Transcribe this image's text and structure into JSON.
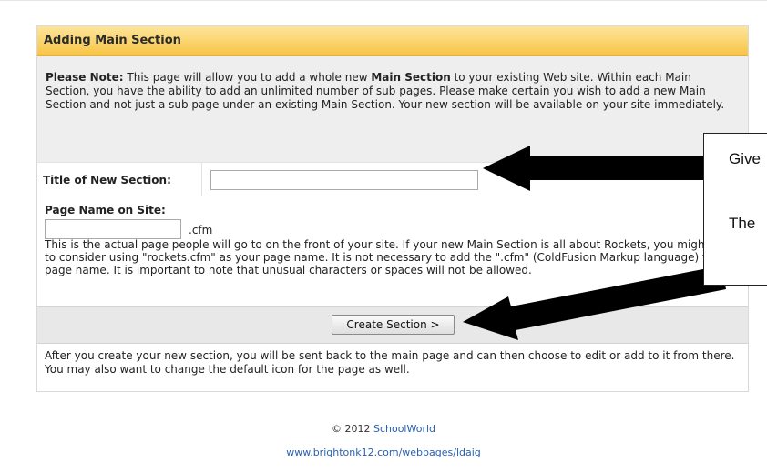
{
  "header": {
    "title": "Adding Main Section"
  },
  "note": {
    "lead": "Please Note:",
    "text1": " This page will allow you to add a whole new ",
    "emphasis": "Main Section",
    "text2": " to your existing Web site. Within each Main Section, you have the ability to add an unlimited number of sub pages. Please make certain you wish to add a new Main Section and not just a sub page under an existing Main Section. Your new section will be available on your site immediately."
  },
  "form": {
    "title_label": "Title of New Section:",
    "title_value": "",
    "page_name_label": "Page Name on Site:",
    "page_name_value": "",
    "page_name_suffix": ".cfm",
    "page_name_description": "This is the actual page people will go to on the front of your site. If your new Main Section is all about Rockets, you might want to consider using \"rockets.cfm\" as your page name. It is not necessary to add the \".cfm\" (ColdFusion Markup language) to the page name. It is important to note that unusual characters or spaces will not be allowed.",
    "submit_label": "Create Section >"
  },
  "after_text": "After you create your new section, you will be sent back to the main page and can then choose to edit or add to it from there. You may also want to change the default icon for the page as well.",
  "footer": {
    "copyright": "© 2012",
    "company": "SchoolWorld",
    "url": "www.brightonk12.com/webpages/ldaig"
  },
  "callout": {
    "line1": "Give",
    "line2": "The"
  }
}
